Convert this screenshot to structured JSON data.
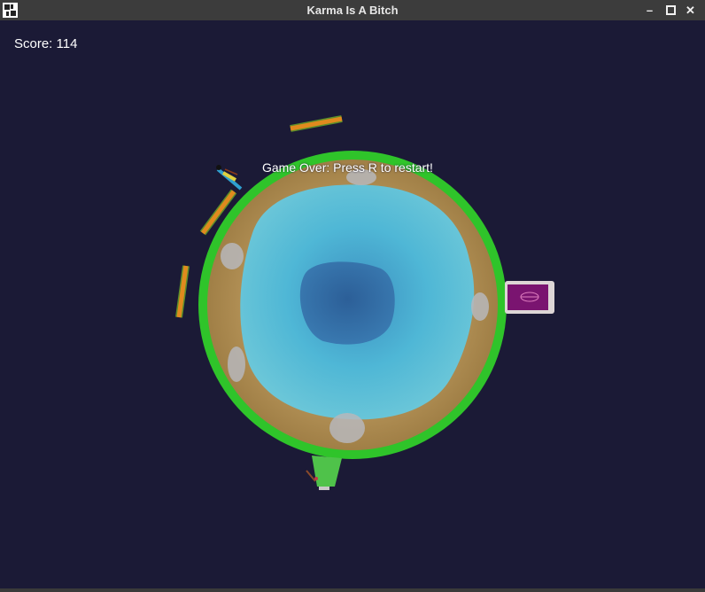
{
  "window": {
    "title": "Karma Is A Bitch",
    "minimize_glyph": "–",
    "close_glyph": "✕"
  },
  "hud": {
    "score_text": "Score: 114",
    "game_over_text": "Game Over: Press R to restart!"
  },
  "colors": {
    "background": "#1b1a36",
    "titlebar": "#3c3c3c",
    "planet_rim": "#2fc42a",
    "planet_sand": "#b08a4e",
    "planet_water": "#4bb6d4",
    "planet_deep_water": "#2f6aa0",
    "barrier": "#e08a1e",
    "barrier_edge": "#5c8f2a",
    "rug": "#7a1470"
  },
  "icons": {
    "app_icon": "app-icon",
    "minimize": "minimize-icon",
    "maximize": "maximize-icon",
    "close": "close-icon"
  }
}
